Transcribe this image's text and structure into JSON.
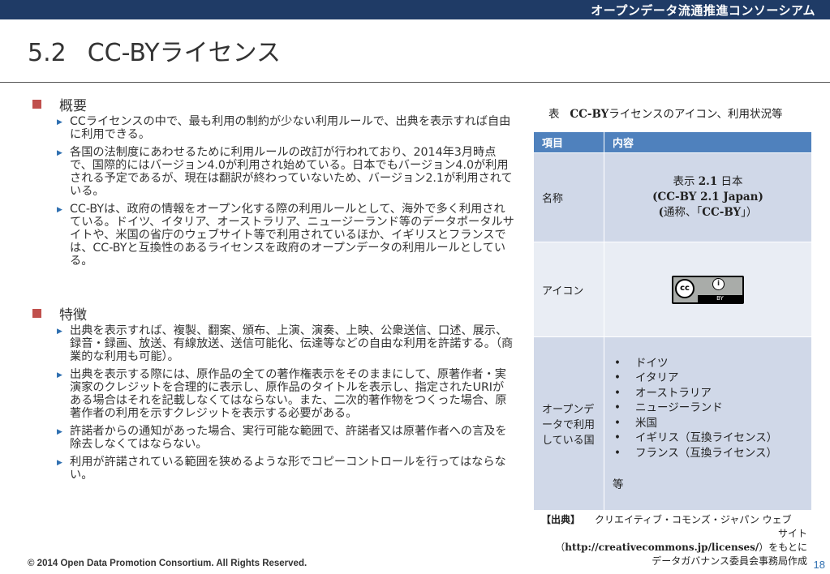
{
  "header": {
    "org": "オープンデータ流通推進コンソーシアム"
  },
  "slide": {
    "number": "5.2",
    "title": "CC-BYライセンス"
  },
  "sections": [
    {
      "heading": "概要",
      "items": [
        "CCライセンスの中で、最も利用の制約が少ない利用ルールで、出典を表示すれば自由に利用できる。",
        "各国の法制度にあわせるために利用ルールの改訂が行われており、2014年3月時点で、国際的にはバージョン4.0が利用され始めている。日本でもバージョン4.0が利用される予定であるが、現在は翻訳が終わっていないため、バージョン2.1が利用されている。",
        "CC-BYは、政府の情報をオープン化する際の利用ルールとして、海外で多く利用されている。ドイツ、イタリア、オーストラリア、ニュージーランド等のデータポータルサイトや、米国の省庁のウェブサイト等で利用されているほか、イギリスとフランスでは、CC-BYと互換性のあるライセンスを政府のオープンデータの利用ルールとしている。"
      ]
    },
    {
      "heading": "特徴",
      "items": [
        "出典を表示すれば、複製、翻案、頒布、上演、演奏、上映、公衆送信、口述、展示、録音・録画、放送、有線放送、送信可能化、伝達等などの自由な利用を許諾する。（商業的な利用も可能）。",
        "出典を表示する際には、原作品の全ての著作権表示をそのままにして、原著作者・実演家のクレジットを合理的に表示し、原作品のタイトルを表示し、指定されたURIがある場合はそれを記載しなくてはならない。また、二次的著作物をつくった場合、原著作者の利用を示すクレジットを表示する必要がある。",
        "許諾者からの通知があった場合、実行可能な範囲で、許諾者又は原著作者への言及を除去しなくてはならない。",
        "利用が許諾されている範囲を狭めるような形でコピーコントロールを行ってはならない。"
      ]
    }
  ],
  "table": {
    "caption_prefix": "表",
    "caption_bold": "CC-BY",
    "caption_rest": "ライセンスのアイコン、利用状況等",
    "headers": [
      "項目",
      "内容"
    ],
    "name_row": {
      "label": "名称",
      "line1_a": "表示 ",
      "line1_b": "2.1",
      "line1_c": " 日本",
      "line2": "(CC-BY 2.1 Japan)",
      "line3_a": "(",
      "line3_b": "通称、「",
      "line3_c": "CC-BY",
      "line3_d": "」）"
    },
    "icon_row": {
      "label": "アイコン",
      "badge_cc": "cc",
      "badge_by_icon": "i",
      "badge_by": "BY"
    },
    "countries_row": {
      "label": "オープンデータで利用している国",
      "bullet": "•",
      "countries": [
        "ドイツ",
        "イタリア",
        "オーストラリア",
        "ニュージーランド",
        "米国",
        "イギリス（互換ライセンス）",
        "フランス（互換ライセンス）"
      ],
      "etc": "等"
    }
  },
  "source": {
    "tag": "【出典】",
    "line1": "クリエイティブ・コモンズ・ジャパン ウェブ",
    "line2": "サイト",
    "line3_open": "（",
    "url": "http://creativecommons.jp/licenses/",
    "line3_close": "）をもとに",
    "line4": "データガバナンス委員会事務局作成"
  },
  "footer": {
    "copyright": "© 2014 Open Data Promotion Consortium. All Rights Reserved.",
    "page": "18"
  },
  "colors": {
    "topbar": "#1f3b66",
    "bullet_square": "#c0504d",
    "table_header": "#4f81bd",
    "table_row_dark": "#d0d8e8",
    "table_row_light": "#e9edf4"
  }
}
